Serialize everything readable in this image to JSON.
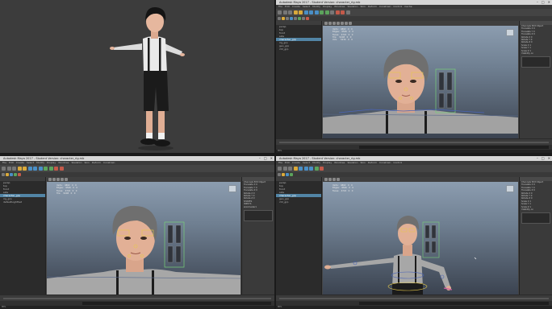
{
  "maya": {
    "title": "Autodesk Maya 2017 - Student Version: character_rig.mb",
    "window_buttons": [
      "–",
      "□",
      "✕"
    ],
    "menus": [
      "File",
      "Edit",
      "Create",
      "Select",
      "Modify",
      "Display",
      "Windows",
      "Skeleton",
      "Skin",
      "Deform",
      "Constrain",
      "Control",
      "Cache"
    ],
    "outliner_rows": [
      "persp",
      "top",
      "front",
      "side",
      "character_grp",
      "rig_grp",
      "geo_grp",
      "ctrl_grp",
      "defaultLightSet",
      "defaultObjectSet"
    ],
    "outliner_selected_index": 4,
    "hud_lines": [
      "Verts:   4802   0   0",
      "Edges:   9526   0   0",
      "Faces:   4724   0   0",
      "Tris:    9448   0   0",
      "UVs:     5230   0   0"
    ],
    "attr_rows": [
      "Channels  Edit  Object",
      "Translate X   0",
      "Translate Y   0",
      "Translate Z   0",
      "Rotate X   0",
      "Rotate Y   0",
      "Rotate Z   0",
      "Scale X   1",
      "Scale Y   1",
      "Scale Z   1",
      "Visibility  on",
      "SHAPES",
      "INPUTS",
      "skinCluster1"
    ],
    "cmd_label": "MEL"
  },
  "colors": {
    "shirt": "#9c9c9c",
    "suspenders": "#1c1c1c",
    "hair": "#6f6f6f",
    "skin": "#e2b096",
    "shorts": "#1b1b1b",
    "rig_yellow": "#e6c94a",
    "rig_green": "#78d078",
    "selection_blue": "#5285a6"
  }
}
